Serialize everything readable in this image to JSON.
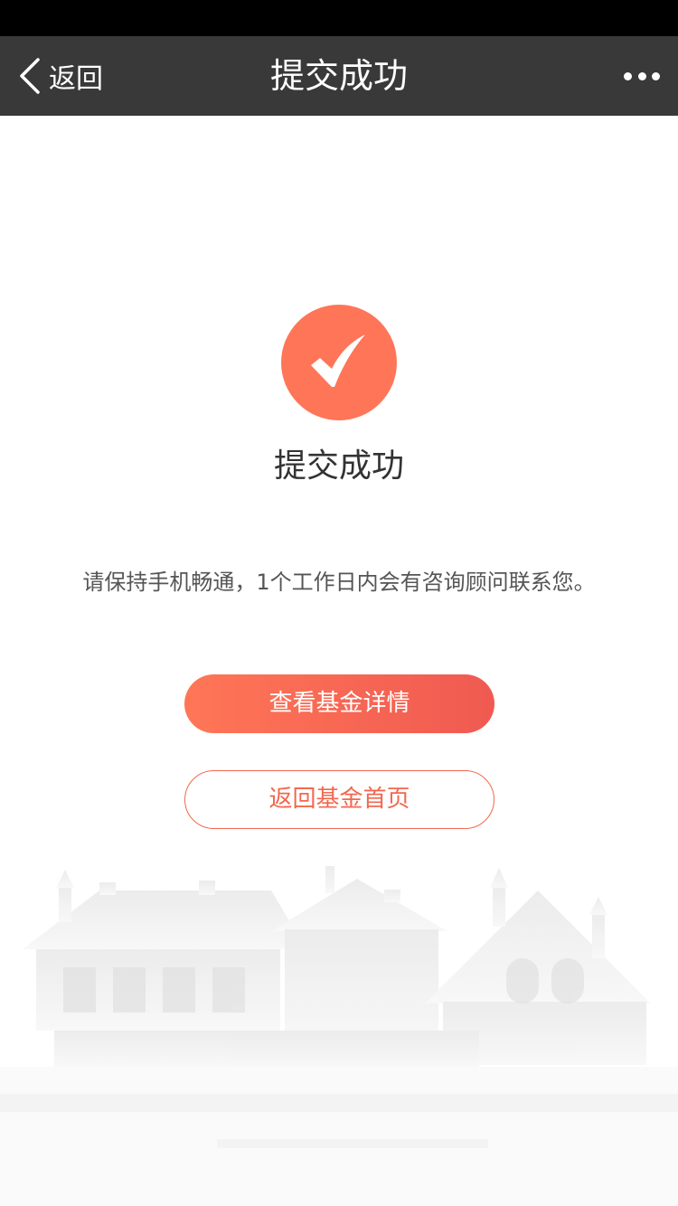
{
  "nav": {
    "back_label": "返回",
    "title": "提交成功",
    "more_icon": "more-dots-icon"
  },
  "result": {
    "icon": "checkmark-icon",
    "icon_color": "#ff7558",
    "title": "提交成功",
    "notice": "请保持手机畅通，1个工作日内会有咨询顾问联系您。"
  },
  "actions": {
    "primary_label": "查看基金详情",
    "secondary_label": "返回基金首页",
    "accent_color": "#f2684f"
  },
  "colors": {
    "status_bar": "#000000",
    "nav_bar": "#393939"
  }
}
